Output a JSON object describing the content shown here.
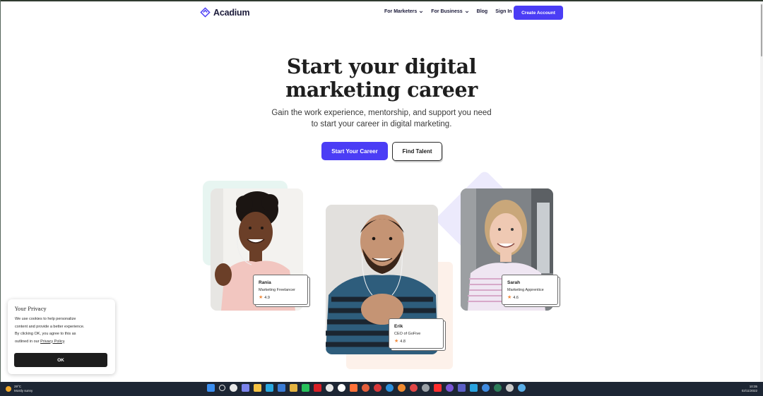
{
  "nav": {
    "brand": "Acadium",
    "links": [
      {
        "label": "For Marketers",
        "dropdown": true
      },
      {
        "label": "For Business",
        "dropdown": true
      },
      {
        "label": "Blog",
        "dropdown": false
      },
      {
        "label": "Sign In",
        "dropdown": false
      }
    ],
    "cta": "Create Account"
  },
  "hero": {
    "title_line1": "Start your digital",
    "title_line2": "marketing career",
    "subtitle_line1": "Gain the work experience, mentorship, and support you need",
    "subtitle_line2": "to start your career in digital marketing.",
    "primary_button": "Start Your Career",
    "secondary_button": "Find Talent"
  },
  "profiles": [
    {
      "name": "Rania",
      "role": "Marketing Freelancer",
      "rating": "4.9"
    },
    {
      "name": "Erik",
      "role": "CEO of GoFive",
      "rating": "4.8"
    },
    {
      "name": "Sarah",
      "role": "Marketing Apprentice",
      "rating": "4.6"
    }
  ],
  "cookie": {
    "title": "Your Privacy",
    "line1": "We use cookies to help personalize",
    "line2": "content and provide a better experience.",
    "line3": "By clicking OK, you agree to this as",
    "line4_prefix": "outlined in our ",
    "link": "Privacy Policy",
    "line4_suffix": ".",
    "ok": "OK"
  },
  "taskbar": {
    "weather_temp": "29°C",
    "weather_desc": "Mostly sunny",
    "time": "10:35",
    "date": "02/11/2022",
    "icon_names": [
      "windows-start",
      "search",
      "task-view",
      "chat",
      "file-explorer",
      "edge",
      "store",
      "chrome",
      "whatsapp",
      "netflix",
      "app",
      "app",
      "firefox",
      "app",
      "app",
      "app",
      "app",
      "app",
      "app",
      "youtube",
      "app",
      "teams",
      "telegram",
      "app",
      "app",
      "app",
      "app"
    ],
    "icon_colors": [
      "#3b8ef0",
      "#e8e8e8",
      "#e8e8e8",
      "#7b83eb",
      "#f6c343",
      "#2aa8e0",
      "#3a7bd5",
      "#e3b341",
      "#27c15b",
      "#d81f26",
      "#e8e8e8",
      "#ffffff",
      "#ff7139",
      "#e45e3b",
      "#d8383a",
      "#2b8fdc",
      "#f08a30",
      "#e04646",
      "#9aa0a6",
      "#ff2e2e",
      "#7a55d6",
      "#5b5fc7",
      "#2aa3e0",
      "#3f8be0",
      "#2d7d5a",
      "#c9c9c9",
      "#5aaee8"
    ]
  }
}
